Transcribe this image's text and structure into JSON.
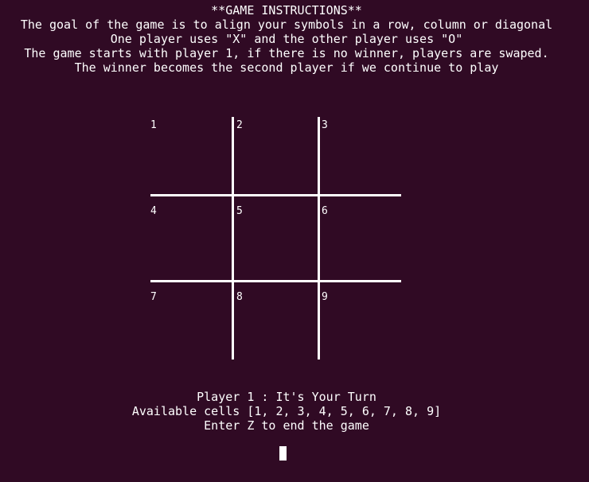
{
  "instructions": {
    "title": "**GAME INSTRUCTIONS**",
    "line1": "The goal of the game is to align your symbols in a row, column or diagonal",
    "line2": "One player uses \"X\" and the other player uses \"O\"",
    "line3": "The game starts with player 1, if there is no winner, players are swaped.",
    "line4": "The winner becomes the second player if we continue to play"
  },
  "board": {
    "cells": [
      "1",
      "2",
      "3",
      "4",
      "5",
      "6",
      "7",
      "8",
      "9"
    ]
  },
  "status": {
    "turn": "Player 1 : It's Your Turn",
    "available": "Available cells [1, 2, 3, 4, 5, 6, 7, 8, 9]",
    "exit_hint": "Enter Z to end the game"
  }
}
